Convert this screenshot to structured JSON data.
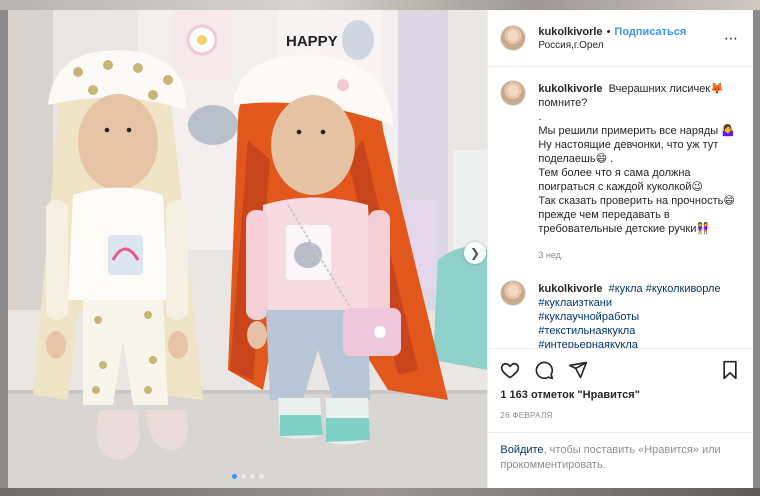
{
  "post": {
    "username": "kukolkivorle",
    "separator": "•",
    "follow_label": "Подписаться",
    "location": "Россия,г.Орел",
    "more_icon": "more-horizontal-icon"
  },
  "photo": {
    "sign_text": "HAPPY",
    "carousel_next_icon": "chevron-right-icon",
    "carousel_dots": 4,
    "active_dot": 0
  },
  "caption": {
    "username": "kukolkivorle",
    "lines": [
      "Вчерашних лисичек🦊 помните?",
      ".",
      "Мы решили примерить все наряды 🤷‍♀️ Ну настоящие девчонки, что уж тут поделаешь😄 .",
      "Тем более что я сама должна поиграться с каждой куколкой😉",
      "Так сказать проверить на прочность😄 прежде чем передавать в требовательные детские ручки👭"
    ],
    "time": "3 нед."
  },
  "hashtags_comment": {
    "username": "kukolkivorle",
    "tags": [
      "#кукла",
      "#куколкиворле",
      "#куклаизткани",
      "#куклаучнойработы",
      "#текстильнаякукла",
      "#интерьернаякукла"
    ]
  },
  "actions": {
    "like_icon": "heart-icon",
    "comment_icon": "comment-icon",
    "share_icon": "share-icon",
    "save_icon": "bookmark-icon",
    "likes_label": "1 163 отметок \"Нравится\"",
    "date": "26 ФЕВРАЛЯ"
  },
  "login": {
    "link": "Войдите",
    "text": ", чтобы поставить «Нравится» или прокомментировать."
  },
  "colors": {
    "accent": "#3897f0",
    "link_dark": "#00376b",
    "muted": "#8e8e8e",
    "text": "#262626"
  }
}
